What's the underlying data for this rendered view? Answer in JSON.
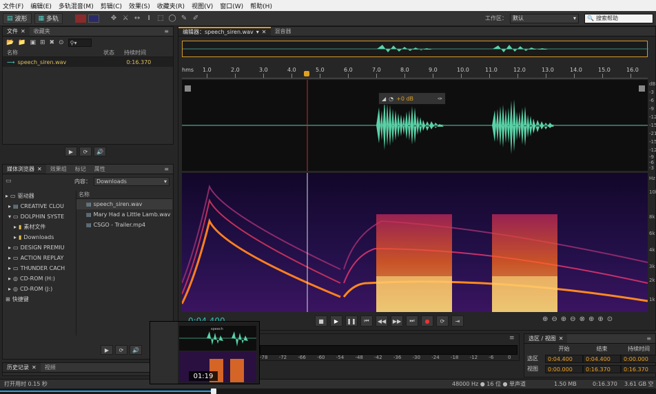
{
  "menu": [
    "文件(F)",
    "编辑(E)",
    "多轨混音(M)",
    "剪辑(C)",
    "效果(S)",
    "收藏夹(R)",
    "视图(V)",
    "窗口(W)",
    "帮助(H)"
  ],
  "toolbar": {
    "waveform_label": "波形",
    "multitrack_label": "多轨",
    "workspace_label": "工作区：",
    "workspace_value": "默认",
    "search_placeholder": "搜索帮助"
  },
  "files_panel": {
    "tabs": [
      "文件",
      "收藏夹"
    ],
    "col_name": "名称",
    "col_status": "状态",
    "col_duration": "持续时间",
    "file_name": "speech_siren.wav",
    "file_duration": "0:16.370"
  },
  "media_panel": {
    "tabs": [
      "媒体浏览器",
      "效果组",
      "标记",
      "属性"
    ],
    "content_label": "内容：",
    "content_value": "Downloads",
    "col_name": "名称",
    "tree": [
      {
        "label": "驱动器",
        "level": 0
      },
      {
        "label": "CREATIVE CLOU",
        "level": 1
      },
      {
        "label": "DOLPHIN SYSTE",
        "level": 1
      },
      {
        "label": "素材文件",
        "level": 2
      },
      {
        "label": "Downloads",
        "level": 2
      },
      {
        "label": "DESIGN PREMIU",
        "level": 1
      },
      {
        "label": "ACTION REPLAY",
        "level": 1
      },
      {
        "label": "THUNDER CACH",
        "level": 1
      },
      {
        "label": "CD-ROM (H:)",
        "level": 1
      },
      {
        "label": "CD-ROM (J:)",
        "level": 1
      },
      {
        "label": "快捷键",
        "level": 0
      }
    ],
    "files": [
      "speech_siren.wav",
      "Mary Had a Little Lamb.wav",
      "CSGO - Trailer.mp4"
    ]
  },
  "editor": {
    "tab_label": "编辑器：speech_siren.wav",
    "mixer_tab": "混音器",
    "ruler_unit": "hms",
    "ruler_labels": [
      "1.0",
      "2.0",
      "3.0",
      "4.0",
      "5.0",
      "6.0",
      "7.0",
      "8.0",
      "9.0",
      "10.0",
      "11.0",
      "12.0",
      "13.0",
      "14.0",
      "15.0",
      "16.0"
    ],
    "hud_gain": "+0 dB",
    "db_labels": [
      "dB",
      "-3",
      "-6",
      "-9",
      "-12",
      "-15",
      "-21",
      "-15",
      "-12",
      "-9",
      "-6",
      "-3"
    ],
    "hz_labels": [
      "Hz",
      "10k",
      "8k",
      "6k",
      "4k",
      "3k",
      "2k",
      "1k"
    ],
    "current_time": "0:04.400"
  },
  "levels": {
    "labels": [
      "-78",
      "-72",
      "-66",
      "-60",
      "-54",
      "-48",
      "-42",
      "-36",
      "-30",
      "-24",
      "-18",
      "-12",
      "-6",
      "0"
    ]
  },
  "selection_panel": {
    "title": "选区 / 视图",
    "col_start": "开始",
    "col_end": "结束",
    "col_duration": "持续时间",
    "row_selection": "选区",
    "row_view": "视图",
    "sel_start": "0:04.400",
    "sel_end": "0:04.400",
    "sel_duration": "0:00.000",
    "view_start": "0:00.000",
    "view_end": "0:16.370",
    "view_duration": "0:16.370"
  },
  "history_panel": {
    "tabs": [
      "历史记录",
      "视频"
    ]
  },
  "statusbar": {
    "left": "打开用时 0.15 秒",
    "format": "48000 Hz ● 16 位 ● 单声道",
    "size": "1.50 MB",
    "duration": "0:16.370",
    "free": "3.61 GB 空"
  },
  "video_overlay": {
    "time": "01:19",
    "preview_title": "speech"
  }
}
